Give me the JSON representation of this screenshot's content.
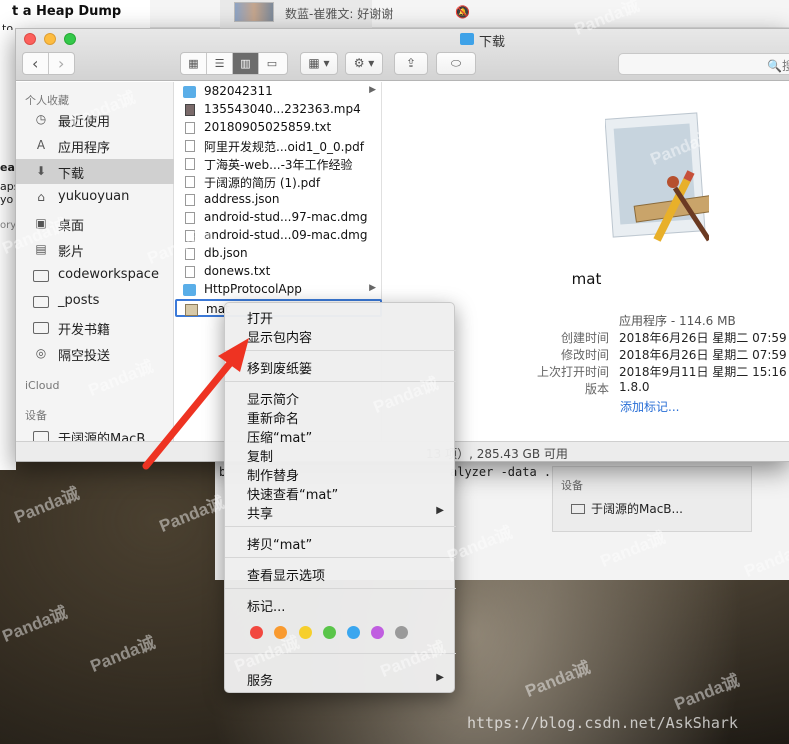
{
  "background": {
    "blog_title": "t a Heap Dump",
    "blog_to": "to",
    "left_strip": [
      "ea",
      "aps",
      "yo",
      "ory"
    ],
    "chat_message": "数蓝-崔雅文: 好谢谢",
    "terminal_b": "b",
    "terminal_cmd": "alyzer -data ..",
    "device_header": "设备",
    "device_name": "于阔源的MacB..."
  },
  "finder": {
    "title": "下载",
    "title_icon": "downloads-folder-icon",
    "toolbar": {
      "back": "‹",
      "forward": "›",
      "views": [
        "icon-view-icon",
        "list-view-icon",
        "column-view-icon",
        "cover-flow-icon"
      ],
      "active_view": 2,
      "arrange": "arrange-icon",
      "action": "gear-icon",
      "share": "share-icon",
      "tag": "tag-icon",
      "search_placeholder": "搜索"
    },
    "sidebar": {
      "favorites_header": "个人收藏",
      "items": [
        {
          "label": "最近使用",
          "icon": "clock-icon"
        },
        {
          "label": "应用程序",
          "icon": "applications-icon"
        },
        {
          "label": "下载",
          "icon": "download-icon",
          "selected": true
        },
        {
          "label": "yukuoyuan",
          "icon": "home-icon"
        },
        {
          "label": "桌面",
          "icon": "desktop-icon"
        },
        {
          "label": "影片",
          "icon": "film-icon"
        },
        {
          "label": "codeworkspace",
          "icon": "folder-icon"
        },
        {
          "label": "_posts",
          "icon": "folder-icon"
        },
        {
          "label": "开发书籍",
          "icon": "folder-icon"
        },
        {
          "label": "隔空投送",
          "icon": "airdrop-icon"
        }
      ],
      "icloud_header": "iCloud",
      "devices_header": "设备",
      "device_item": "于阔源的MacB..."
    },
    "files": [
      {
        "name": "982042311",
        "type": "folder",
        "arrow": true
      },
      {
        "name": "135543040...232363.mp4",
        "type": "video"
      },
      {
        "name": "20180905025859.txt",
        "type": "doc"
      },
      {
        "name": "阿里开发规范...oid1_0_0.pdf",
        "type": "doc"
      },
      {
        "name": "丁海英-web...-3年工作经验",
        "type": "doc"
      },
      {
        "name": "于阔源的简历 (1).pdf",
        "type": "doc"
      },
      {
        "name": "address.json",
        "type": "doc"
      },
      {
        "name": "android-stud...97-mac.dmg",
        "type": "doc"
      },
      {
        "name": "android-stud...09-mac.dmg",
        "type": "doc"
      },
      {
        "name": "db.json",
        "type": "doc"
      },
      {
        "name": "donews.txt",
        "type": "doc"
      },
      {
        "name": "HttpProtocolApp",
        "type": "folder",
        "arrow": true
      },
      {
        "name": "mat",
        "type": "app",
        "selected": true
      }
    ],
    "preview": {
      "name": "mat",
      "kind": "应用程序 - 114.6 MB",
      "rows": [
        {
          "key": "创建时间",
          "value": "2018年6月26日 星期二 07:59"
        },
        {
          "key": "修改时间",
          "value": "2018年6月26日 星期二 07:59"
        },
        {
          "key": "上次打开时间",
          "value": "2018年9月11日 星期二 15:16"
        },
        {
          "key": "版本",
          "value": "1.8.0"
        }
      ],
      "add_tags": "添加标记..."
    },
    "status": "13 项）, 285.43 GB 可用"
  },
  "context_menu": {
    "items": [
      {
        "label": "打开"
      },
      {
        "label": "显示包内容"
      },
      {
        "sep": true
      },
      {
        "label": "移到废纸篓"
      },
      {
        "sep": true
      },
      {
        "label": "显示简介"
      },
      {
        "label": "重新命名"
      },
      {
        "label": "压缩“mat”"
      },
      {
        "label": "复制"
      },
      {
        "label": "制作替身"
      },
      {
        "label": "快速查看“mat”"
      },
      {
        "label": "共享",
        "submenu": true
      },
      {
        "sep": true
      },
      {
        "label": "拷贝“mat”"
      },
      {
        "sep": true
      },
      {
        "label": "查看显示选项"
      },
      {
        "sep": true
      },
      {
        "label": "标记..."
      },
      {
        "sep": true
      },
      {
        "label": "服务",
        "submenu": true
      }
    ],
    "tag_colors": [
      "#f2483f",
      "#f99a2f",
      "#f6cf2c",
      "#5ac54a",
      "#3aa6ef",
      "#c05ee0",
      "#9a9a9a"
    ]
  },
  "watermark_text": "Panda诚",
  "footer_url": "https://blog.csdn.net/AskShark",
  "annotation_color": "#ee3322"
}
